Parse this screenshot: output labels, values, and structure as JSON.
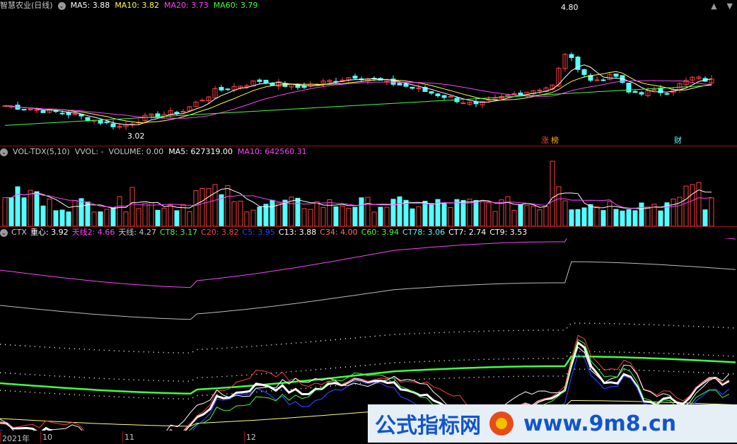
{
  "main": {
    "title": "智慧农业(日线)",
    "ma5": "MA5: 3.88",
    "ma10": "MA10: 3.82",
    "ma20": "MA20: 3.73",
    "ma60": "MA60: 3.79",
    "high_label": "4.80",
    "low_label": "3.02",
    "tag_zt": "涨",
    "tag_lhb": "榜",
    "tag_cai": "财"
  },
  "vol": {
    "title": "VOL-TDX(5,10)",
    "vvol": "VVOL: -",
    "volume": "VOLUME: 0.00",
    "ma5": "MA5: 627319.00",
    "ma10": "MA10: 642560.31"
  },
  "ctx": {
    "title": "CTX",
    "zx": "重心: 3.92",
    "tx2": "天线2: 4.66",
    "tx": "天线: 4.27",
    "ct8": "CT8: 3.17",
    "c20": "C20: 3.82",
    "c5": "C5: 3.95",
    "c13": "C13: 3.88",
    "c34": "C34: 4.00",
    "c60": "C60: 3.94",
    "ct78": "CT78: 3.06",
    "ct7": "CT7: 2.74",
    "ct9": "CT9: 3.53"
  },
  "axis": {
    "year": "2021年",
    "m10": "10",
    "m11": "11",
    "m12": "12"
  },
  "watermark": {
    "cn": "公式指标网",
    "url": "www.9m8.cn"
  },
  "colors": {
    "up": "#ff4040",
    "down": "#54ffff",
    "ma5": "#ffffff",
    "ma10": "#ffff40",
    "ma20": "#ff40ff",
    "ma60": "#40ff40"
  }
}
